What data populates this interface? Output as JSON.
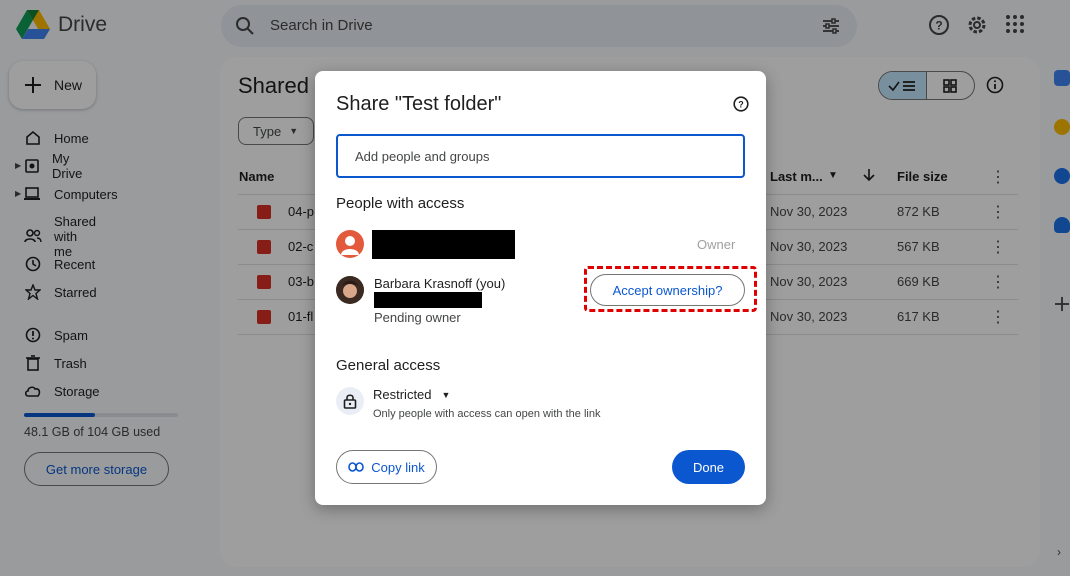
{
  "app": {
    "name": "Drive"
  },
  "search": {
    "placeholder": "Search in Drive"
  },
  "sidebar": {
    "new_label": "New",
    "items": [
      {
        "label": "Home",
        "icon": "home-icon"
      },
      {
        "label": "My Drive",
        "icon": "my-drive-icon"
      },
      {
        "label": "Computers",
        "icon": "computers-icon"
      },
      {
        "label": "Shared with me",
        "icon": "shared-icon"
      },
      {
        "label": "Recent",
        "icon": "clock-icon"
      },
      {
        "label": "Starred",
        "icon": "star-icon"
      },
      {
        "label": "Spam",
        "icon": "spam-icon"
      },
      {
        "label": "Trash",
        "icon": "trash-icon"
      },
      {
        "label": "Storage",
        "icon": "cloud-icon"
      }
    ],
    "storage_used_fraction": 0.4625,
    "storage_text": "48.1 GB of 104 GB used",
    "get_storage_label": "Get more storage"
  },
  "main": {
    "title": "Shared w",
    "type_filter": "Type",
    "columns": {
      "name": "Name",
      "modified": "Last m...",
      "size": "File size"
    },
    "rows": [
      {
        "name": "04-p",
        "modified": "Nov 30, 2023",
        "size": "872 KB"
      },
      {
        "name": "02-c",
        "modified": "Nov 30, 2023",
        "size": "567 KB"
      },
      {
        "name": "03-b",
        "modified": "Nov 30, 2023",
        "size": "669 KB"
      },
      {
        "name": "01-fl",
        "modified": "Nov 30, 2023",
        "size": "617 KB"
      }
    ]
  },
  "dialog": {
    "title": "Share \"Test folder\"",
    "input_placeholder": "Add people and groups",
    "people_section": "People with access",
    "owner_label": "Owner",
    "person_name": "Barbara Krasnoff (you)",
    "pending_label": "Pending owner",
    "accept_label": "Accept ownership?",
    "general_section": "General access",
    "access_level": "Restricted",
    "access_desc": "Only people with access can open with the link",
    "copy_link_label": "Copy link",
    "done_label": "Done"
  },
  "colors": {
    "accent": "#0b57d0",
    "highlight": "#e00000",
    "selected_toggle": "#c2e7ff"
  }
}
